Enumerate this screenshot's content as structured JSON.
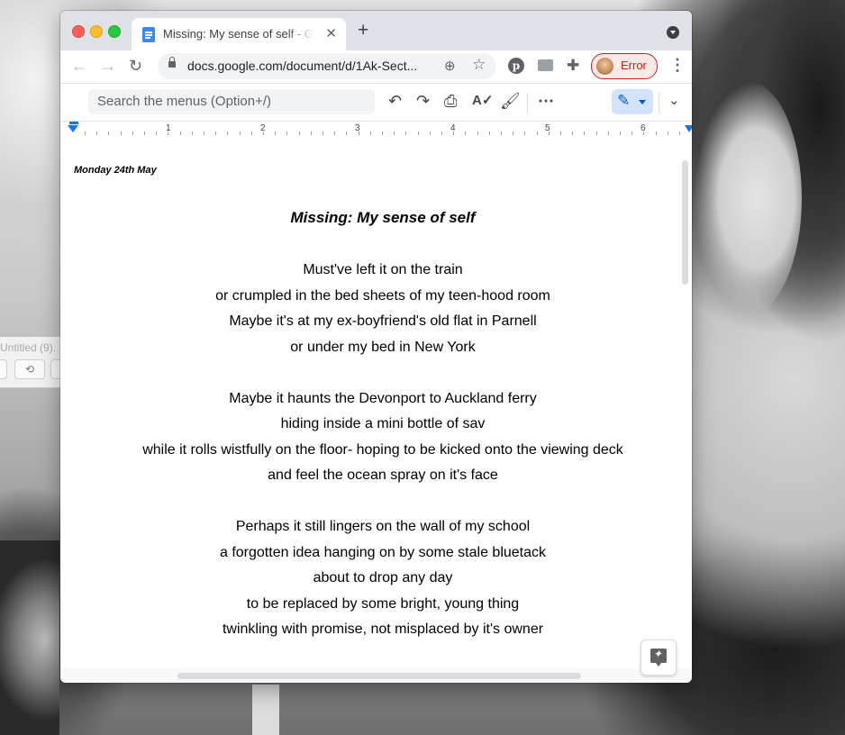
{
  "background_window": {
    "title": "Untitled (9)."
  },
  "browser": {
    "tab": {
      "title": "Missing: My sense of self - Google Docs",
      "close": "✕"
    },
    "new_tab": "+",
    "address_bar": {
      "url": "docs.google.com/document/d/1Ak-Sect..."
    },
    "profile": {
      "label": "Error",
      "status_color": "#c5221f"
    },
    "extensions": [
      "pinterest-icon",
      "card-icon",
      "puzzle-icon"
    ]
  },
  "docs_toolbar": {
    "menu_search_placeholder": "Search the menus (Option+/)",
    "tools": [
      "undo-icon",
      "redo-icon",
      "print-icon",
      "spellcheck-icon",
      "paint-format-icon",
      "more-icon"
    ],
    "mode": "editing",
    "accent": "#0b57d0"
  },
  "ruler": {
    "numbers": [
      "1",
      "2",
      "3",
      "4",
      "5",
      "6"
    ]
  },
  "document": {
    "date": "Monday 24th May",
    "title": "Missing: My sense of self",
    "stanzas": [
      [
        "Must've left it on the train",
        "or crumpled in the bed sheets of my teen-hood room",
        "Maybe it's at my ex-boyfriend's old flat in Parnell",
        "or under my bed in New York"
      ],
      [
        "Maybe it haunts the Devonport to Auckland ferry",
        "hiding inside a mini bottle of sav",
        "while it rolls wistfully on the floor- hoping to be kicked onto the viewing deck",
        "and feel the ocean spray on it's face"
      ],
      [
        "Perhaps it still lingers on the wall of my school",
        "a forgotten idea hanging on by some stale bluetack",
        "about to drop any day",
        "to be replaced by some bright, young thing",
        "twinkling with promise, not misplaced by it's owner"
      ]
    ]
  }
}
